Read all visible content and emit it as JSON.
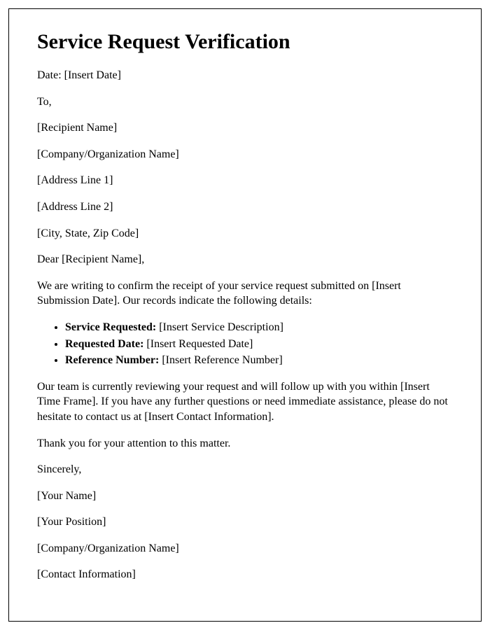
{
  "title": "Service Request Verification",
  "date_line": "Date: [Insert Date]",
  "to_line": "To,",
  "recipient_name": "[Recipient Name]",
  "company_name": "[Company/Organization Name]",
  "address_line_1": "[Address Line 1]",
  "address_line_2": "[Address Line 2]",
  "city_state_zip": "[City, State, Zip Code]",
  "salutation": "Dear [Recipient Name],",
  "intro_paragraph": "We are writing to confirm the receipt of your service request submitted on [Insert Submission Date]. Our records indicate the following details:",
  "details": {
    "service_label": "Service Requested:",
    "service_value": " [Insert Service Description]",
    "date_label": "Requested Date:",
    "date_value": " [Insert Requested Date]",
    "ref_label": "Reference Number:",
    "ref_value": " [Insert Reference Number]"
  },
  "followup_paragraph": "Our team is currently reviewing your request and will follow up with you within [Insert Time Frame]. If you have any further questions or need immediate assistance, please do not hesitate to contact us at [Insert Contact Information].",
  "thanks": "Thank you for your attention to this matter.",
  "closing": "Sincerely,",
  "sender_name": "[Your Name]",
  "sender_position": "[Your Position]",
  "sender_company": "[Company/Organization Name]",
  "sender_contact": "[Contact Information]"
}
